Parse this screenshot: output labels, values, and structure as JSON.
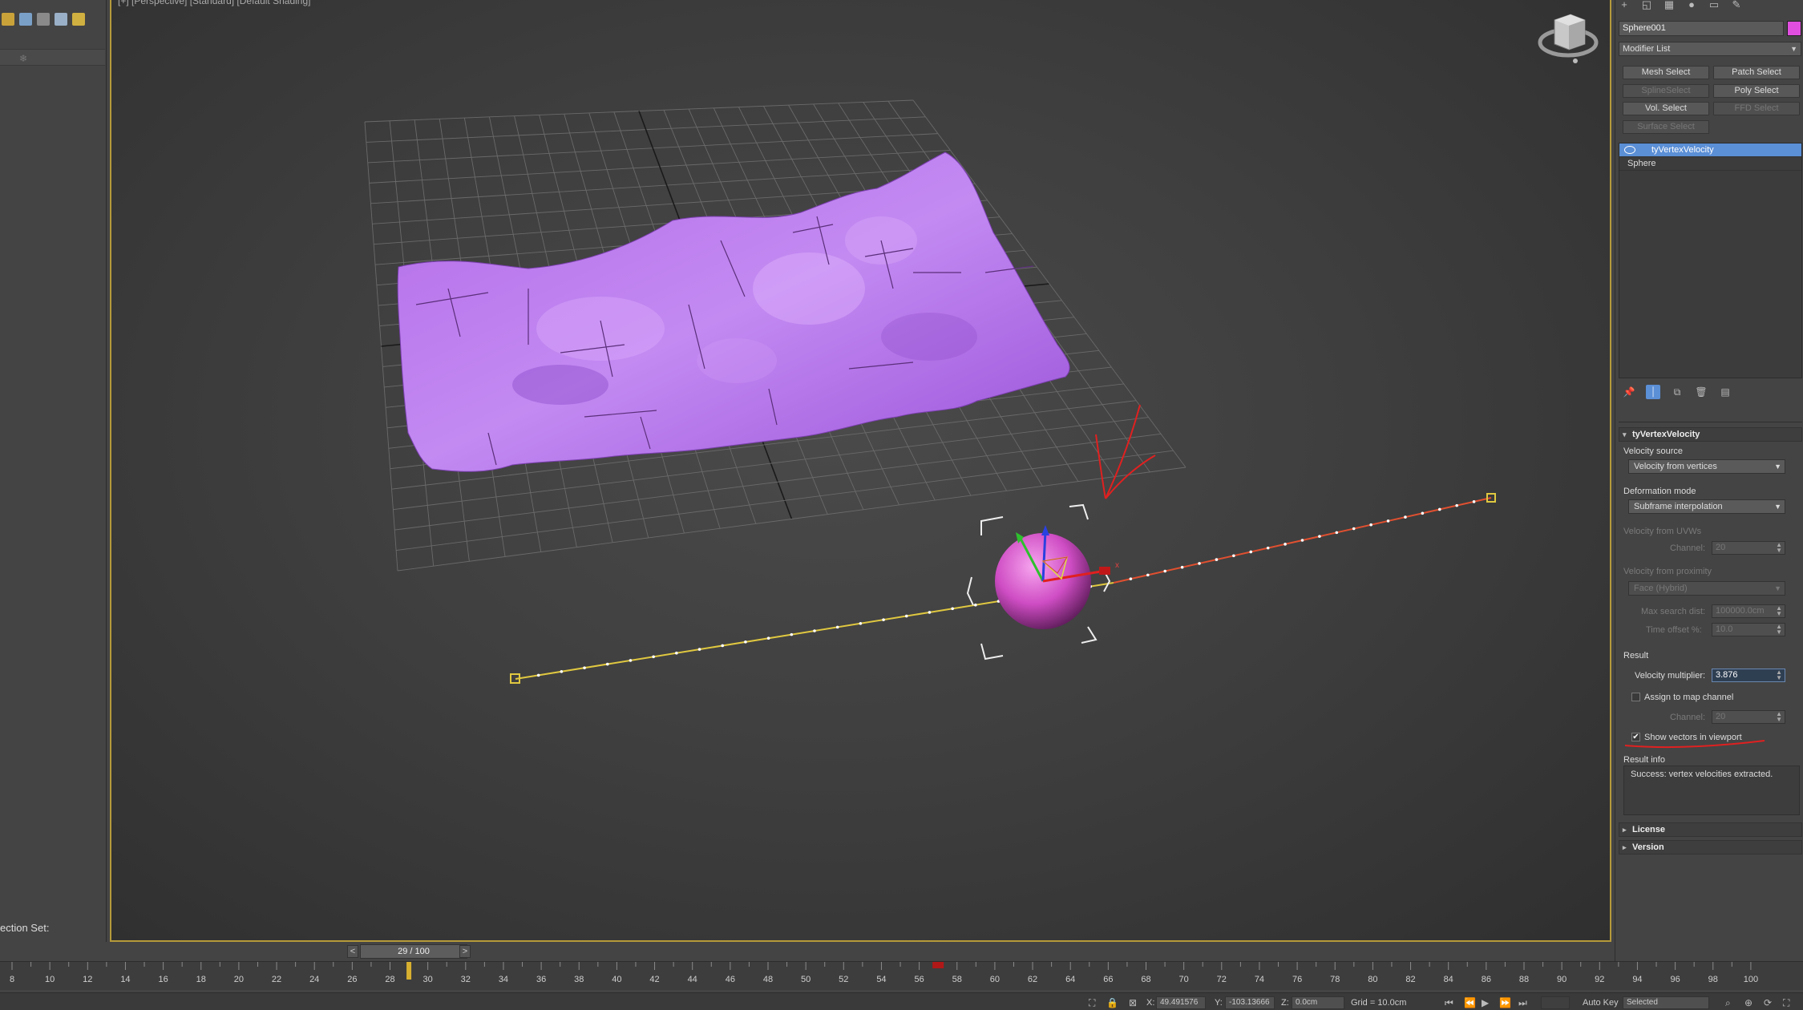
{
  "viewport": {
    "label": "[+] [Perspective] [Standard] [Default Shading]"
  },
  "left_panel": {
    "selection_set_label": "ection Set:"
  },
  "command_panel": {
    "object_name": "Sphere001",
    "object_color": "#e04ee0",
    "modifier_list": "Modifier List",
    "buttons": {
      "mesh_select": "Mesh Select",
      "patch_select": "Patch Select",
      "spline_select": "SplineSelect",
      "poly_select": "Poly Select",
      "vol_select": "Vol. Select",
      "ffd_select": "FFD Select",
      "surface_select": "Surface Select"
    },
    "stack": [
      "tyVertexVelocity",
      "Sphere"
    ],
    "rollout_title": "tyVertexVelocity",
    "velocity_source_label": "Velocity source",
    "velocity_source_value": "Velocity from vertices",
    "deformation_mode_label": "Deformation mode",
    "deformation_mode_value": "Subframe interpolation",
    "velocity_from_uvws_label": "Velocity from UVWs",
    "channel_label": "Channel:",
    "channel_value": "20",
    "velocity_from_proximity_label": "Velocity from proximity",
    "proximity_mode_value": "Face (Hybrid)",
    "max_search_dist_label": "Max search dist:",
    "max_search_dist_value": "100000.0cm",
    "time_offset_label": "Time offset %:",
    "time_offset_value": "10.0",
    "result_label": "Result",
    "velocity_multiplier_label": "Velocity multiplier:",
    "velocity_multiplier_value": "3.876",
    "assign_to_map_channel_label": "Assign to map channel",
    "result_channel_label": "Channel:",
    "result_channel_value": "20",
    "show_vectors_label": "Show vectors in viewport",
    "show_vectors_checked": true,
    "result_info_label": "Result info",
    "result_info_text": "Success: vertex velocities extracted.",
    "license_label": "License",
    "version_label": "Version"
  },
  "time_slider": {
    "frame_display": "29 / 100",
    "prev": "<",
    "next": ">"
  },
  "track_bar": {
    "tick_labels": [
      "8",
      "10",
      "12",
      "14",
      "16",
      "18",
      "20",
      "22",
      "24",
      "26",
      "28",
      "30",
      "32",
      "34",
      "36",
      "38",
      "40",
      "42",
      "44",
      "46",
      "48",
      "50",
      "52",
      "54",
      "56",
      "58",
      "60",
      "62",
      "64",
      "66",
      "68",
      "70",
      "72",
      "74",
      "76",
      "78",
      "80",
      "82",
      "84",
      "86",
      "88",
      "90",
      "92",
      "94",
      "96",
      "98",
      "100"
    ],
    "current_frame": 29
  },
  "status_bar": {
    "x_label": "X:",
    "x_value": "49.491576",
    "y_label": "Y:",
    "y_value": "-103.13666",
    "z_label": "Z:",
    "z_value": "0.0cm",
    "grid": "Grid = 10.0cm",
    "auto_key": "Auto Key",
    "selected": "Selected"
  },
  "colors": {
    "viewport_border": "#b59a3a",
    "highlight": "#5b8fd6",
    "mesh": "#b466e8",
    "sphere": "#d054c8",
    "trail_before": "#e0c840",
    "trail_after": "#e05030",
    "annotation": "#e02020"
  }
}
